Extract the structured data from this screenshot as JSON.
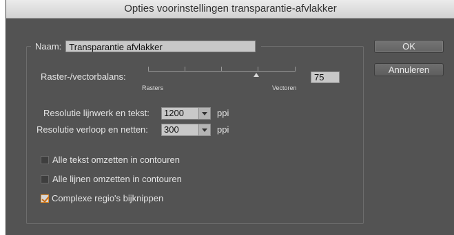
{
  "window": {
    "title": "Opties voorinstellingen transparantie-afvlakker"
  },
  "name_field": {
    "label": "Naam:",
    "value": "Transparantie afvlakker"
  },
  "raster_vector": {
    "label": "Raster-/vectorbalans:",
    "min_label": "Rasters",
    "max_label": "Vectoren",
    "value": "75",
    "slider_fraction": 0.75
  },
  "line_art_resolution": {
    "label": "Resolutie lijnwerk en tekst:",
    "value": "1200",
    "unit": "ppi"
  },
  "gradient_resolution": {
    "label": "Resolutie verloop en netten:",
    "value": "300",
    "unit": "ppi"
  },
  "options": [
    {
      "label": "Alle tekst omzetten in contouren",
      "checked": false
    },
    {
      "label": "Alle lijnen omzetten in contouren",
      "checked": false
    },
    {
      "label": "Complexe regio's bijknippen",
      "checked": true
    }
  ],
  "buttons": {
    "ok": "OK",
    "cancel": "Annuleren"
  },
  "colors": {
    "panel_bg": "#535353",
    "checkbox_accent": "#e8902a"
  },
  "icons": {
    "dropdown": "chevron-down-icon",
    "checkmark": "checkmark-icon",
    "slider_thumb": "triangle-up-icon"
  }
}
